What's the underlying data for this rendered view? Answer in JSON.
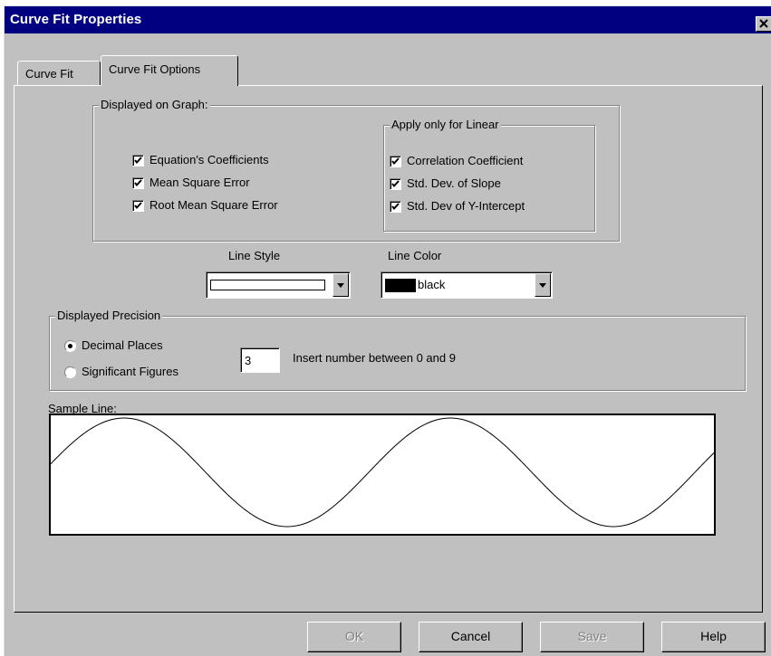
{
  "window": {
    "title": "Curve Fit Properties"
  },
  "tabs": [
    {
      "label": "Curve Fit",
      "active": false
    },
    {
      "label": "Curve Fit Options",
      "active": true
    }
  ],
  "displayed_on_graph": {
    "label": "Displayed on Graph:",
    "options": [
      {
        "label": "Equation's Coefficients",
        "checked": true
      },
      {
        "label": "Mean Square Error",
        "checked": true
      },
      {
        "label": "Root Mean Square Error",
        "checked": true
      }
    ]
  },
  "linear_only": {
    "label": "Apply only for Linear",
    "options": [
      {
        "label": "Correlation Coefficient",
        "checked": true
      },
      {
        "label": "Std. Dev. of Slope",
        "checked": true
      },
      {
        "label": "Std. Dev of Y-Intercept",
        "checked": true
      }
    ]
  },
  "line_style": {
    "label": "Line Style"
  },
  "line_color": {
    "label": "Line Color",
    "value": "black",
    "swatch": "#000000"
  },
  "precision": {
    "label": "Displayed Precision",
    "options": [
      {
        "label": "Decimal Places",
        "selected": true
      },
      {
        "label": "Significant Figures",
        "selected": false
      }
    ],
    "value": "3",
    "hint": "Insert number between 0 and 9"
  },
  "sample": {
    "label": "Sample Line:"
  },
  "buttons": {
    "ok": "OK",
    "cancel": "Cancel",
    "save": "Save",
    "help": "Help"
  },
  "colors": {
    "titlebar": "#000080",
    "face": "#c0c0c0",
    "disabled_text": "#808080"
  },
  "icons": {
    "close": "close-icon",
    "checkbox_check": "check-icon",
    "dropdown": "chevron-down-icon"
  }
}
